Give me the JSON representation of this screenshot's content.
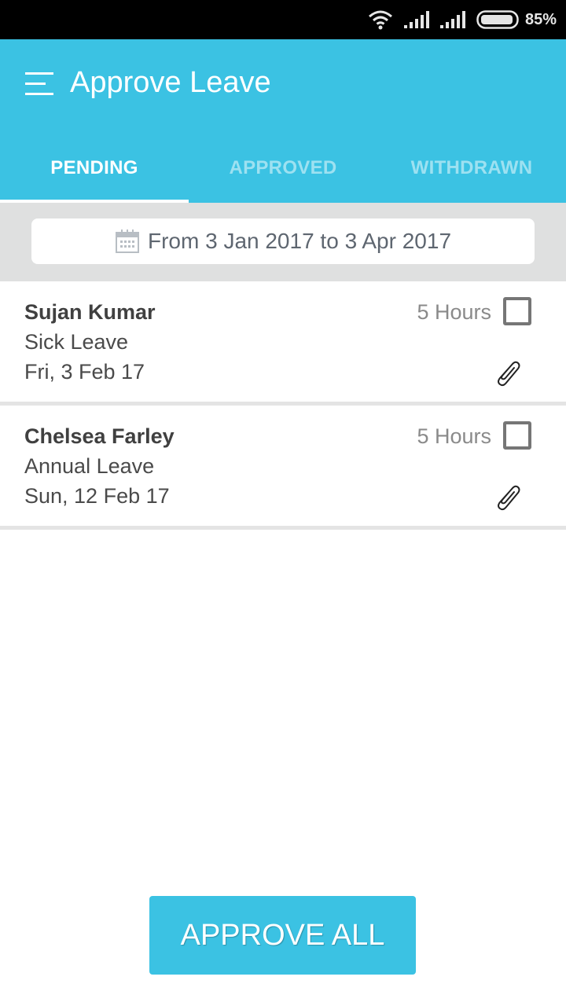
{
  "status_bar": {
    "icons": [
      "wifi-icon",
      "cell-signal-icon",
      "cell-signal-icon",
      "battery-icon"
    ],
    "battery_percent": "85%"
  },
  "app_bar": {
    "menu_icon": "hamburger-menu-icon",
    "title": "Approve Leave",
    "background_color": "#3bc2e3"
  },
  "tabs": [
    {
      "label": "PENDING",
      "active": true
    },
    {
      "label": "APPROVED",
      "active": false
    },
    {
      "label": "WITHDRAWN",
      "active": false
    }
  ],
  "filter": {
    "icon": "calendar-icon",
    "date_range": "From 3 Jan 2017 to 3 Apr 2017"
  },
  "leave_requests": [
    {
      "name": "Sujan Kumar",
      "leave_type": "Sick Leave",
      "date": "Fri, 3 Feb 17",
      "duration": "5 Hours",
      "selected": false,
      "has_attachment": true
    },
    {
      "name": "Chelsea Farley",
      "leave_type": "Annual Leave",
      "date": "Sun, 12 Feb 17",
      "duration": "5 Hours",
      "selected": false,
      "has_attachment": true
    }
  ],
  "actions": {
    "approve_all_label": "APPROVE ALL"
  }
}
